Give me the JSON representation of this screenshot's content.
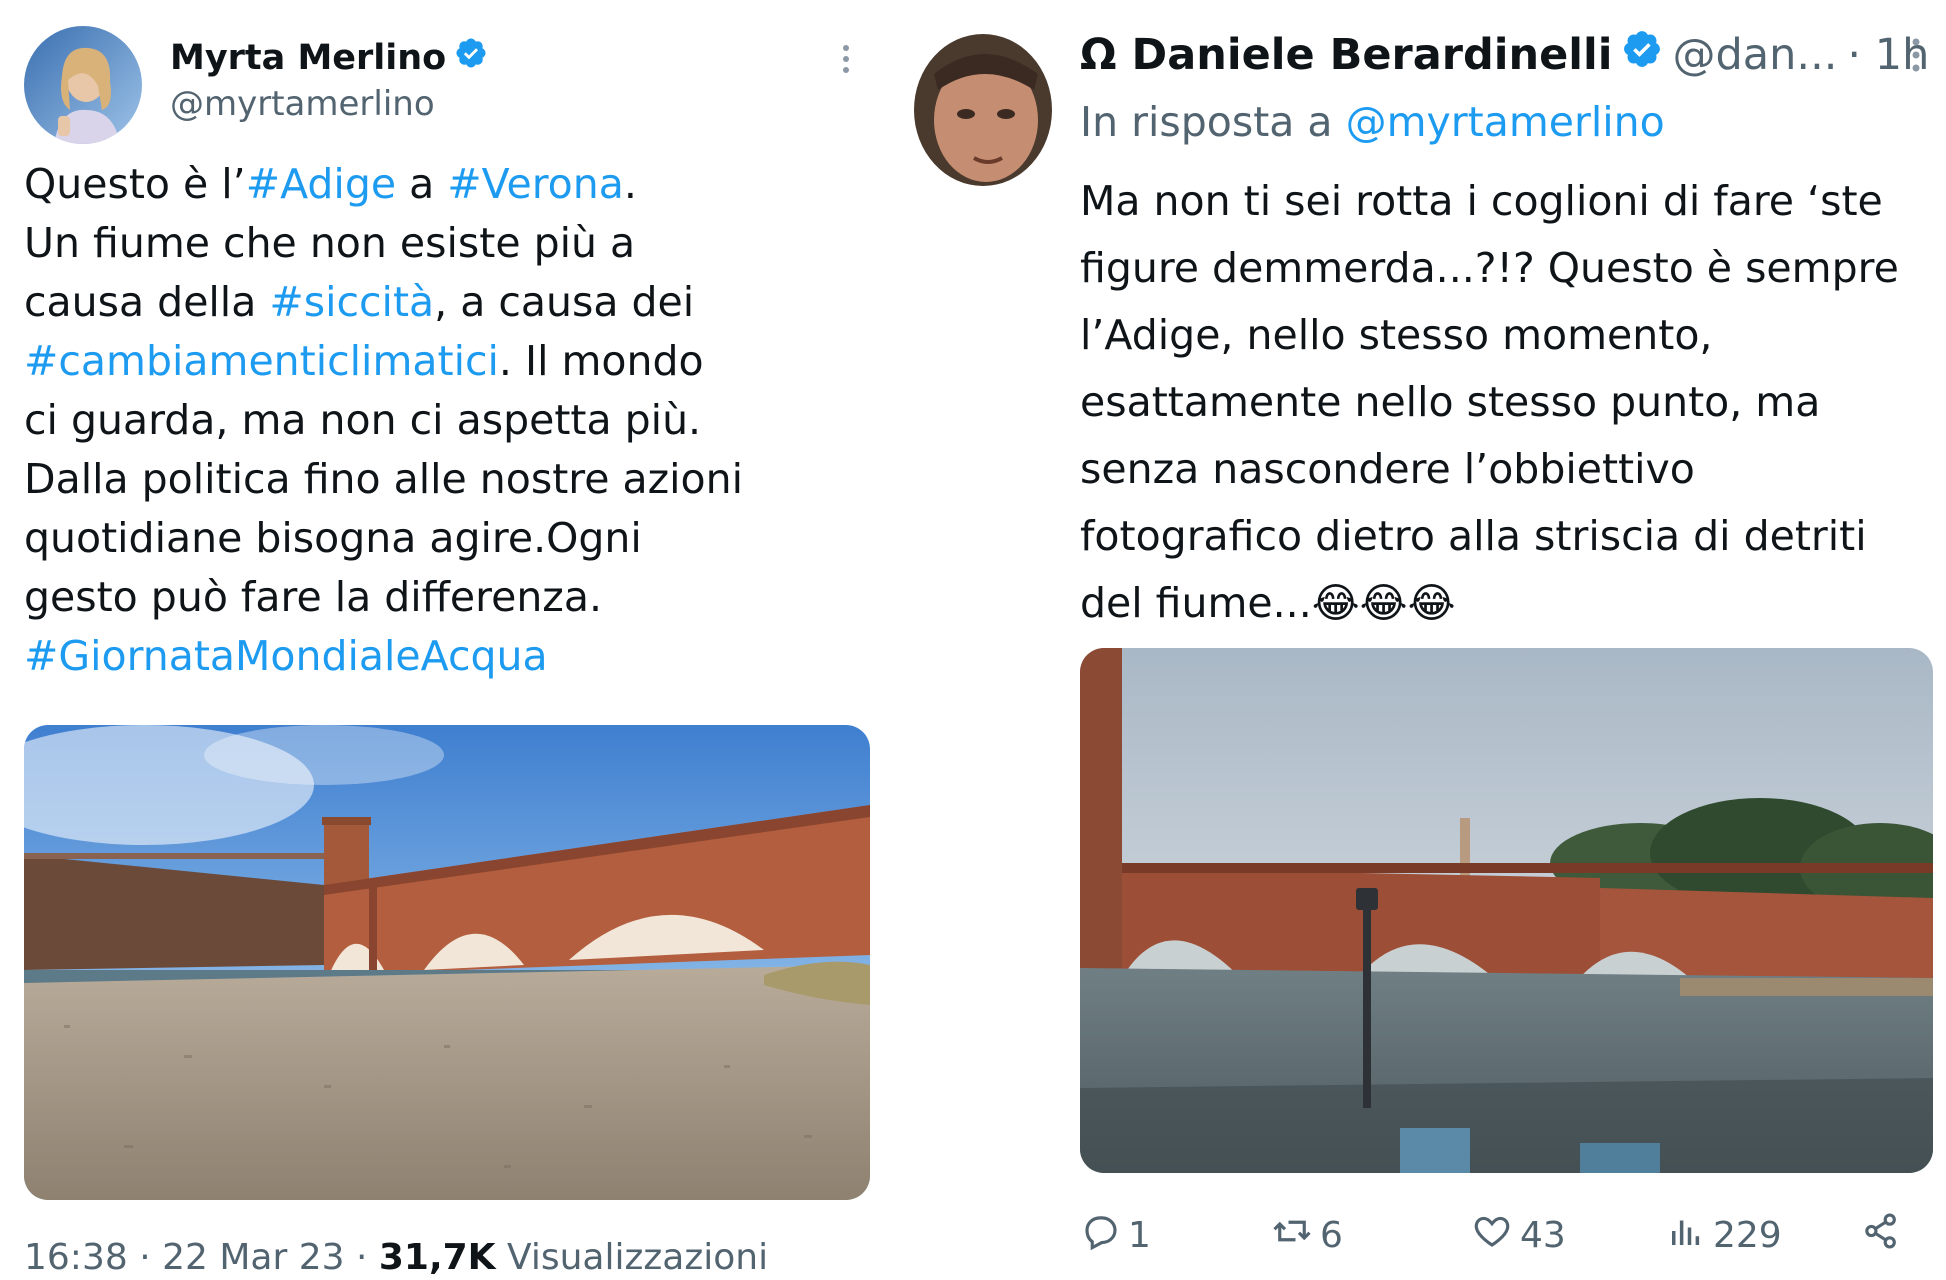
{
  "left_tweet": {
    "author_name": "Myrta Merlino",
    "handle": "@myrtamerlino",
    "text_lines": [
      [
        {
          "t": "Questo è l’",
          "tag": false
        },
        {
          "t": "#Adige",
          "tag": true
        },
        {
          "t": " a ",
          "tag": false
        },
        {
          "t": "#Verona",
          "tag": true
        },
        {
          "t": ".",
          "tag": false
        }
      ],
      [
        {
          "t": "Un fiume che non esiste più a",
          "tag": false
        }
      ],
      [
        {
          "t": "causa della ",
          "tag": false
        },
        {
          "t": "#siccità",
          "tag": true
        },
        {
          "t": ", a causa dei",
          "tag": false
        }
      ],
      [
        {
          "t": "#cambiamenticlimatici",
          "tag": true
        },
        {
          "t": ". Il mondo",
          "tag": false
        }
      ],
      [
        {
          "t": "ci guarda, ma non ci aspetta più.",
          "tag": false
        }
      ],
      [
        {
          "t": "Dalla politica fino alle nostre azioni",
          "tag": false
        }
      ],
      [
        {
          "t": "quotidiane bisogna agire.Ogni",
          "tag": false
        }
      ],
      [
        {
          "t": "gesto può fare la differenza.",
          "tag": false
        }
      ],
      [
        {
          "t": "#GiornataMondialeAcqua",
          "tag": true
        }
      ]
    ],
    "timestamp": "16:38 · 22 Mar 23 · ",
    "views_count": "31,7K",
    "views_label": " Visualizzazioni"
  },
  "right_tweet": {
    "author_name": "Ω Daniele Berardinelli",
    "handle": "@dan...",
    "time": "· 1h",
    "reply_prefix": "In risposta a ",
    "reply_handle": "@myrtamerlino",
    "text_lines": [
      "Ma non ti sei rotta i coglioni di fare ‘ste",
      "figure demmerda...?!? Questo è sempre",
      "l’Adige, nello stesso momento,",
      "esattamente nello stesso punto, ma",
      "senza nascondere l’obbiettivo",
      "fotografico dietro alla striscia di detriti",
      "del fiume..."
    ],
    "emoji": "😂😂😂",
    "actions": {
      "replies": "1",
      "reposts": "6",
      "likes": "43",
      "views": "229"
    }
  },
  "colors": {
    "text": "#0f1419",
    "secondary": "#536471",
    "link": "#1d9bf0",
    "verified": "#1d9bf0"
  },
  "icons": [
    "verified-badge-icon",
    "more-icon",
    "reply-icon",
    "repost-icon",
    "like-icon",
    "views-icon",
    "share-icon"
  ]
}
